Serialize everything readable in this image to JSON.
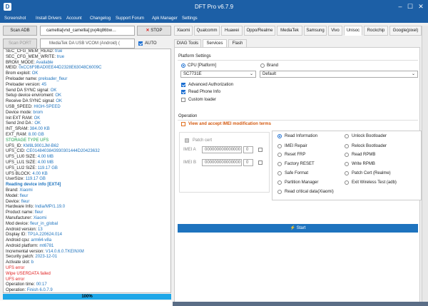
{
  "window": {
    "title": "DFT Pro v6.7.9",
    "icon": "dft-icon",
    "minimize": "–",
    "maximize": "☐",
    "close": "✕"
  },
  "menu": [
    "Screenshot",
    "Install Drivers",
    "Account",
    "Changelog",
    "Support Forum",
    "Apk Manager",
    "Settings"
  ],
  "left": {
    "scan_adb": "Scan ADB",
    "device_combo": "camellia[vnd_camellia]:pvj4lq86bw…",
    "stop": "STOP",
    "scan_port": "Scan PORT",
    "port_combo": "MediaTek DA USB VCOM (Android) (",
    "auto_label": "AUTO",
    "progress": "100%"
  },
  "log": [
    {
      "k": "SEC_CFG_MEM_READ: ",
      "v": "true",
      "c": "#1e73be"
    },
    {
      "k": "SEC_CFG_MEM_WRITE: ",
      "v": "true",
      "c": "#1e73be"
    },
    {
      "k": "BROM_MODE: ",
      "v": "Available",
      "c": "#1e73be"
    },
    {
      "k": "MEID: ",
      "v": "0xCC6F9BAD0EE44D2328E63048C6009C",
      "c": "#1e73be"
    },
    {
      "k": "Brom exploit: ",
      "v": "OK",
      "c": "#1e73be"
    },
    {
      "k": "Preloader name: ",
      "v": "preloader_fleur",
      "c": "#1e73be"
    },
    {
      "k": "Preloader version: ",
      "v": "45",
      "c": "#1e73be"
    },
    {
      "k": "Send DA SYNC signal: ",
      "v": "OK",
      "c": "#1e73be"
    },
    {
      "k": "Setup device enviroment: ",
      "v": "OK",
      "c": "#1e73be"
    },
    {
      "k": "Receive DA SYNC signal: ",
      "v": "OK",
      "c": "#1e73be"
    },
    {
      "k": "USB_SPEED: ",
      "v": "HIGH-SPEED",
      "c": "#1e73be"
    },
    {
      "k": "Device mode: ",
      "v": "brom",
      "c": "#1e73be"
    },
    {
      "k": "Init EXT RAM: ",
      "v": "OK",
      "c": "#1e73be"
    },
    {
      "k": "Send 2nd DA : ",
      "v": "OK",
      "c": "#1e73be"
    },
    {
      "k": "INT_SRAM: ",
      "v": "384.00 KB",
      "c": "#1e73be"
    },
    {
      "k": "EXT_RAM: ",
      "v": "8.00 GB",
      "c": "#1e73be"
    },
    {
      "k": "",
      "v": "STORAGE TYPE UFS",
      "c": "#1aa04a"
    },
    {
      "k": "UFS_ID: ",
      "v": "KM8L9001JM-B62",
      "c": "#1e73be"
    },
    {
      "k": "UFS_CID: ",
      "v": "CE0148403843930301444D20423632",
      "c": "#1e73be"
    },
    {
      "k": "UFS_LU0 SIZE: ",
      "v": "4.00 MB",
      "c": "#1e73be"
    },
    {
      "k": "UFS_LU1 SIZE: ",
      "v": "4.00 MB",
      "c": "#1e73be"
    },
    {
      "k": "UFS_LU2 SIZE: ",
      "v": "119.17 GB",
      "c": "#1e73be"
    },
    {
      "k": "UFS BLOCK: ",
      "v": "4.00 KB",
      "c": "#1e73be"
    },
    {
      "k": "UserSize: ",
      "v": "119.17 GB",
      "c": "#1e73be"
    },
    {
      "k": "",
      "v": "Reading device info [EXT4]",
      "c": "#1e73be",
      "b": true
    },
    {
      "k": "Brand: ",
      "v": "Xiaomi",
      "c": "#1e73be"
    },
    {
      "k": "Model: ",
      "v": "fleur",
      "c": "#1e73be"
    },
    {
      "k": "Device: ",
      "v": "fleur",
      "c": "#1e73be"
    },
    {
      "k": "Hardware Info: ",
      "v": "India/MP/1.19.0",
      "c": "#1e73be"
    },
    {
      "k": "Product name: ",
      "v": "fleur",
      "c": "#1e73be"
    },
    {
      "k": "Manufacturer: ",
      "v": "Xiaomi",
      "c": "#1e73be"
    },
    {
      "k": "Mod device: ",
      "v": "fleur_in_global",
      "c": "#1e73be"
    },
    {
      "k": "Android version: ",
      "v": "13",
      "c": "#1e73be"
    },
    {
      "k": "Display ID: ",
      "v": "TP1A.220624.014",
      "c": "#1e73be"
    },
    {
      "k": "Android cpu: ",
      "v": "arm64-v8a",
      "c": "#1e73be"
    },
    {
      "k": "Android platform: ",
      "v": "mt6781",
      "c": "#1e73be"
    },
    {
      "k": "Incremental version: ",
      "v": "V14.0.6.0.TKEINXM",
      "c": "#1e73be"
    },
    {
      "k": "Security patch: ",
      "v": "2023-12-01",
      "c": "#1e73be"
    },
    {
      "k": "Activate slot: ",
      "v": "b",
      "c": "#1e73be"
    },
    {
      "k": "",
      "v": "UFS error",
      "c": "#e02020"
    },
    {
      "k": "",
      "v": "Wipe USERDATA failed",
      "c": "#e02020"
    },
    {
      "k": "",
      "v": "UFS error",
      "c": "#e02020"
    },
    {
      "k": "Operation time: ",
      "v": "00:17",
      "c": "#1e73be"
    },
    {
      "k": "Operation: ",
      "v": "Finish 6.0.7.9",
      "c": "#1e73be"
    }
  ],
  "brand_tabs": [
    "Xiaomi",
    "Qualcomm",
    "Huawei",
    "Oppo/Realme",
    "MediaTek",
    "Samsung",
    "Vivo",
    "Unisoc",
    "Rockchip",
    "Google(pixel)"
  ],
  "sub_tabs": [
    "DIAG Tools",
    "Services",
    "Flash"
  ],
  "platform": {
    "title": "Platform Settings",
    "cpu_label": "CPU [Platform]",
    "brand_label": "Brand",
    "cpu_value": "SC7731E",
    "brand_value": "Default",
    "opt_adv": "Advanced Authorization",
    "opt_phone": "Read Phone Info",
    "opt_custom": "Custom loader"
  },
  "operation": {
    "title": "Operation",
    "imei_accept": "View and accept IMEI modification terms",
    "patch_cert": "Patch cert",
    "imei_a_label": "IMEI A",
    "imei_b_label": "IMEI B",
    "imei_a_value": "000000000000000",
    "imei_b_value": "000000000000000",
    "imei_a_idx": "0",
    "imei_b_idx": "0",
    "ops_left": [
      "Read Information",
      "IMEI Repair",
      "Reset FRP",
      "Factory RESET",
      "Safe Format",
      "Partition Manager",
      "Read critical data(Xiaomi)"
    ],
    "ops_right": [
      "Unlock Bootloader",
      "Relock Bootloader",
      "Read RPMB",
      "Write RPMB",
      "Patch Cert (Realme)",
      "Exit Wireless Test (adb)"
    ],
    "start": "Start"
  }
}
